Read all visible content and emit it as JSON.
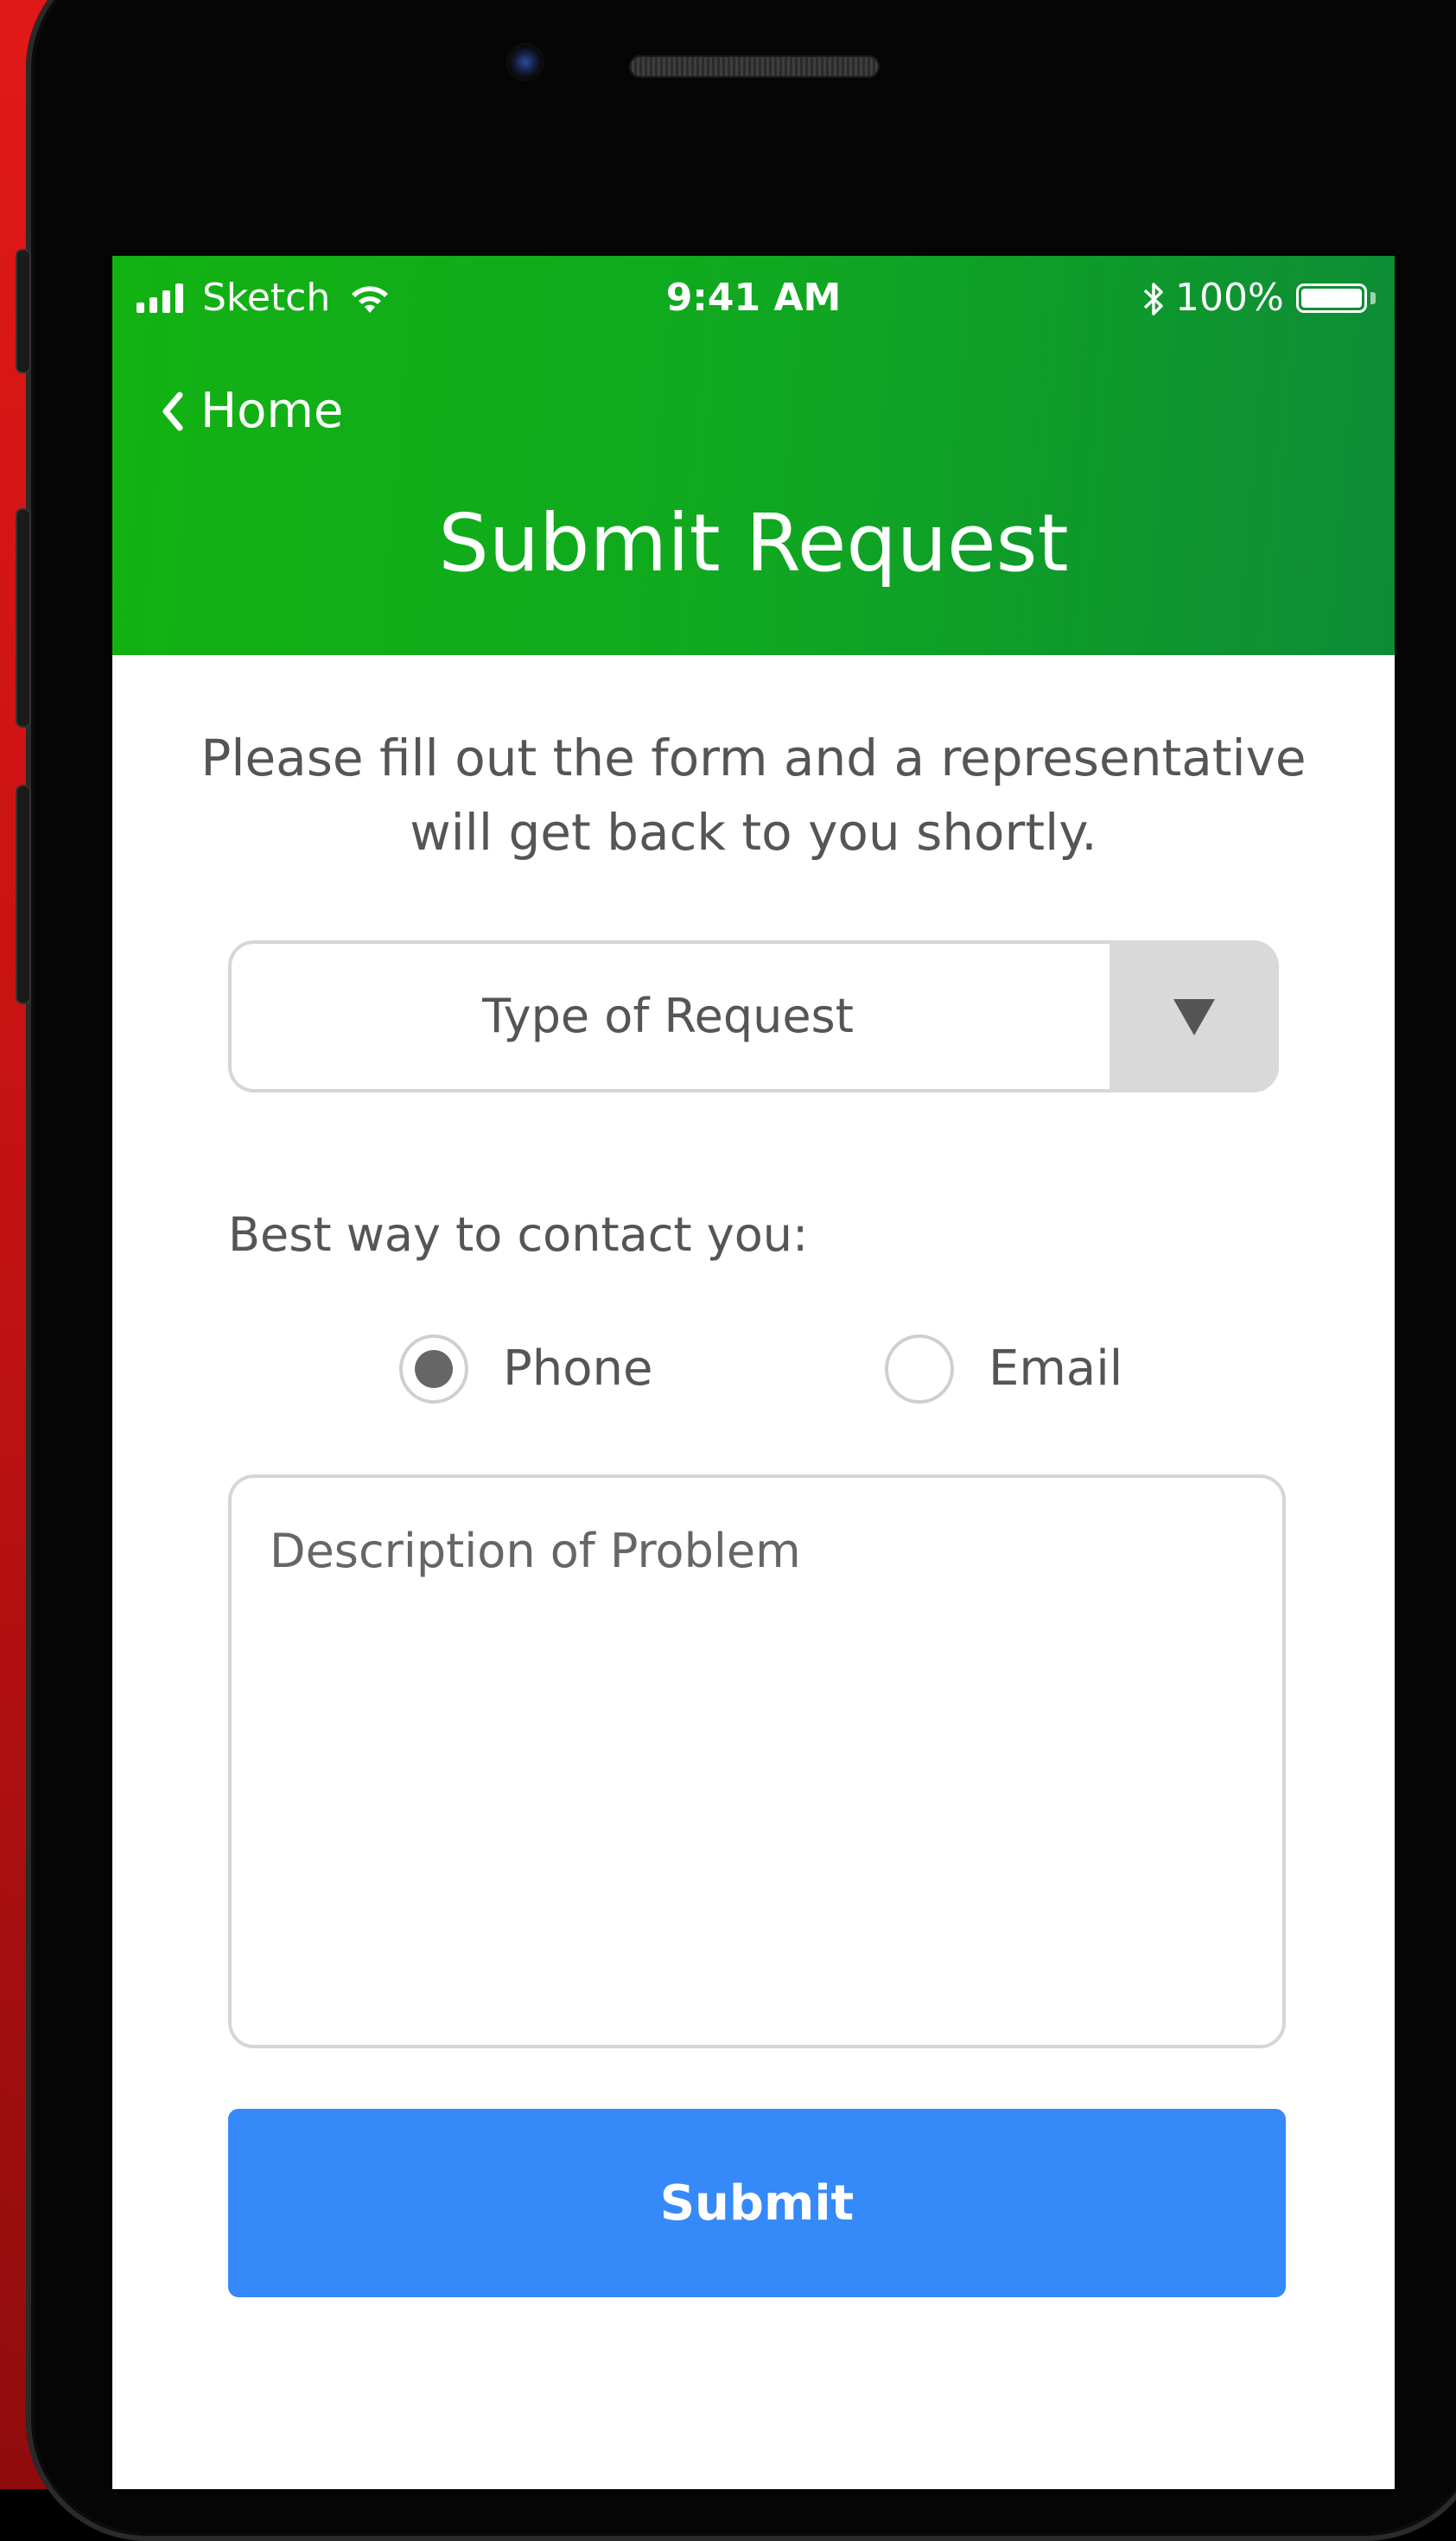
{
  "status_bar": {
    "carrier": "Sketch",
    "time": "9:41 AM",
    "battery_percent": "100%",
    "battery_level": 1.0
  },
  "nav": {
    "back_label": "Home",
    "title": "Submit Request"
  },
  "form": {
    "intro": "Please fill out the form and a representative will get back to you shortly.",
    "request_type": {
      "selected": "Type of Request",
      "arrow_glyph": "▼"
    },
    "contact_label": "Best way to contact you:",
    "contact_options": [
      {
        "label": "Phone",
        "checked": true
      },
      {
        "label": "Email",
        "checked": false
      }
    ],
    "description_placeholder": "Description of Problem",
    "description_value": "",
    "submit_label": "Submit"
  },
  "colors": {
    "header_start": "#12b212",
    "header_end": "#0d8c36",
    "submit": "#3589f9",
    "border": "#d6d6d6",
    "text": "#555555"
  },
  "icons": {
    "status": [
      "signal-icon",
      "wifi-icon",
      "bluetooth-icon",
      "battery-icon"
    ],
    "nav": [
      "chevron-left-icon"
    ],
    "select": [
      "dropdown-arrow-icon"
    ]
  }
}
